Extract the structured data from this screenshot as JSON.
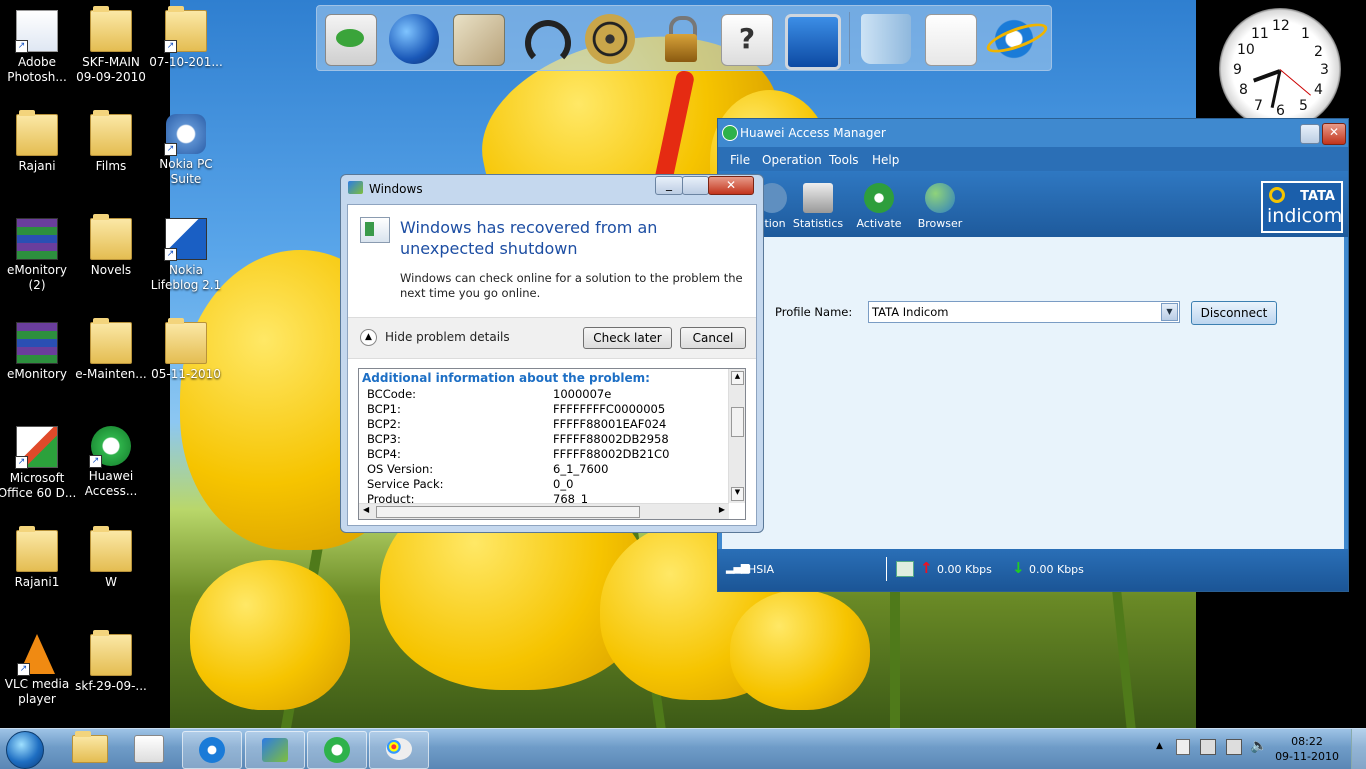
{
  "desktop_icons": [
    {
      "label": "Adobe Photosh...",
      "icon": "photoshop-icon"
    },
    {
      "label": "SKF-MAIN 09-09-2010",
      "icon": "folder-icon"
    },
    {
      "label": "07-10-201...",
      "icon": "folder-icon"
    },
    {
      "label": "Rajani",
      "icon": "folder-icon"
    },
    {
      "label": "Films",
      "icon": "folder-icon"
    },
    {
      "label": "Nokia PC Suite",
      "icon": "nokia-icon"
    },
    {
      "label": "eMonitory (2)",
      "icon": "winrar-icon"
    },
    {
      "label": "Novels",
      "icon": "folder-icon"
    },
    {
      "label": "Nokia Lifeblog 2.1",
      "icon": "lifeblog-icon"
    },
    {
      "label": "eMonitory",
      "icon": "winrar-icon"
    },
    {
      "label": "e-Mainten...",
      "icon": "folder-icon"
    },
    {
      "label": "05-11-2010",
      "icon": "folder-icon"
    },
    {
      "label": "Microsoft Office 60 D...",
      "icon": "office-icon"
    },
    {
      "label": "Huawei Access...",
      "icon": "huawei-icon"
    },
    {
      "label": "Rajani1",
      "icon": "folder-icon"
    },
    {
      "label": "W",
      "icon": "folder-icon"
    },
    {
      "label": "VLC media player",
      "icon": "vlc-icon"
    },
    {
      "label": "skf-29-09-...",
      "icon": "folder-icon"
    }
  ],
  "dock_icons": [
    "mail-icon",
    "globe-icon",
    "photos-icon",
    "headphones-icon",
    "film-reel-icon",
    "lock-icon",
    "help-icon",
    "monitor-icon",
    "recycle-bin-icon",
    "notepad-icon",
    "internet-explorer-icon"
  ],
  "clock": {
    "numbers": [
      "12",
      "1",
      "2",
      "3",
      "4",
      "5",
      "6",
      "7",
      "8",
      "9",
      "10",
      "11"
    ]
  },
  "dialog": {
    "title": "Windows",
    "heading": "Windows has recovered from an unexpected shutdown",
    "message": "Windows can check online for a solution to the problem the next time you go online.",
    "hide_details": "Hide problem details",
    "check_later": "Check later",
    "cancel": "Cancel",
    "details_header": "Additional information about the problem:",
    "details": [
      {
        "key": "BCCode:",
        "value": "1000007e"
      },
      {
        "key": "BCP1:",
        "value": "FFFFFFFFC0000005"
      },
      {
        "key": "BCP2:",
        "value": "FFFFF88001EAF024"
      },
      {
        "key": "BCP3:",
        "value": "FFFFF88002DB2958"
      },
      {
        "key": "BCP4:",
        "value": "FFFFF88002DB21C0"
      },
      {
        "key": "OS Version:",
        "value": "6_1_7600"
      },
      {
        "key": "Service Pack:",
        "value": "0_0"
      },
      {
        "key": "Product:",
        "value": "768_1"
      }
    ]
  },
  "huawei": {
    "title": "Huawei Access Manager",
    "menu": [
      "File",
      "Operation",
      "Tools",
      "Help"
    ],
    "toolbar": [
      "ction",
      "Statistics",
      "Activate",
      "Browser"
    ],
    "brand_top": "TATA",
    "brand_bottom": "indicom",
    "profile_label": "Profile Name:",
    "profile_value": "TATA Indicom",
    "disconnect": "Disconnect",
    "status": {
      "network": "HSIA",
      "upload": "0.00 Kbps",
      "download": "0.00 Kbps"
    }
  },
  "taskbar": {
    "time": "08:22",
    "date": "09-11-2010"
  },
  "colors": {
    "dialog_heading": "#1d4ea3",
    "huawei_blue": "#3f89cf",
    "taskbar": "#6f9cc8"
  }
}
